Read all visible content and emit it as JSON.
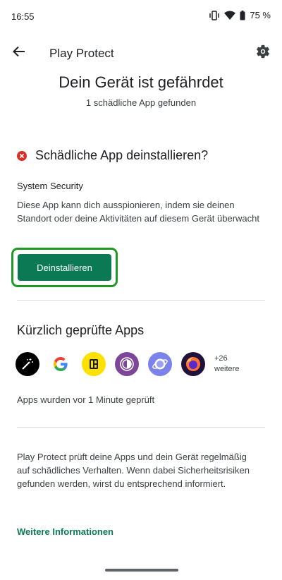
{
  "status_bar": {
    "time": "16:55",
    "battery": "75 %"
  },
  "app_bar": {
    "title": "Play Protect"
  },
  "header": {
    "headline": "Dein Gerät ist gefährdet",
    "subline": "1 schädliche App gefunden"
  },
  "threat": {
    "title": "Schädliche App deinstallieren?",
    "app_name": "System Security",
    "description": "Diese App kann dich ausspionieren, indem sie deinen Standort oder deine Aktivitäten auf diesem Gerät überwacht",
    "button_label": "Deinstallieren"
  },
  "recent": {
    "title": "Kürzlich geprüfte Apps",
    "apps": [
      "magic-wand-app",
      "google-app",
      "yellow-app",
      "tor-browser",
      "samsung-internet",
      "firefox"
    ],
    "more_count": "+26",
    "more_label": "weitere",
    "checked_text": "Apps wurden vor 1 Minute geprüft"
  },
  "info": {
    "text": "Play Protect prüft deine Apps und dein Gerät regelmäßig auf schädliches Verhalten. Wenn dabei Sicherheitsrisiken gefunden werden, wirst du entsprechend informiert.",
    "link": "Weitere Informationen"
  },
  "colors": {
    "accent": "#0b7a54",
    "highlight": "#1e9a24",
    "danger": "#d93025"
  }
}
